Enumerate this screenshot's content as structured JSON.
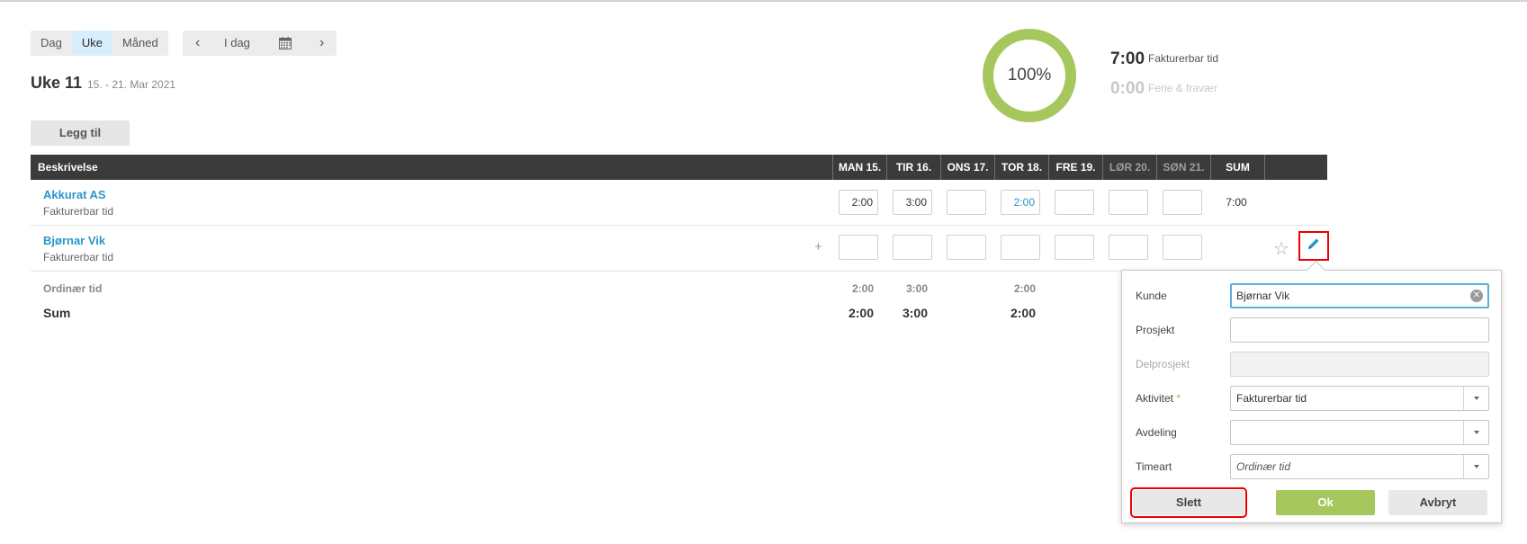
{
  "view_switch": {
    "day": "Dag",
    "week": "Uke",
    "month": "Måned",
    "active": "week"
  },
  "nav": {
    "prev": "‹",
    "today": "I dag",
    "calendar_icon": "calendar-icon",
    "next": "›"
  },
  "week": {
    "title": "Uke 11",
    "range": "15. - 21. Mar 2021"
  },
  "add_button": "Legg til",
  "summary": {
    "percent": "100%",
    "percent_value": 1.0,
    "billable_hours": "7:00",
    "billable_label": "Fakturerbar tid",
    "absence_hours": "0:00",
    "absence_label": "Ferie & fravær",
    "ring_color": "#a5c75c"
  },
  "table": {
    "headers": {
      "description": "Beskrivelse",
      "days": [
        "MAN 15.",
        "TIR 16.",
        "ONS 17.",
        "TOR 18.",
        "FRE 19.",
        "LØR 20.",
        "SØN 21."
      ],
      "sum": "SUM"
    },
    "rows": [
      {
        "name": "Akkurat AS",
        "activity": "Fakturerbar tid",
        "values": [
          "2:00",
          "3:00",
          "",
          "2:00",
          "",
          "",
          ""
        ],
        "sum": "7:00"
      },
      {
        "name": "Bjørnar Vik",
        "activity": "Fakturerbar tid",
        "values": [
          "",
          "",
          "",
          "",
          "",
          "",
          ""
        ],
        "sum": ""
      }
    ],
    "footer": {
      "ordinary_label": "Ordinær tid",
      "ordinary_values": [
        "2:00",
        "3:00",
        "",
        "2:00",
        "",
        "",
        ""
      ],
      "sum_label": "Sum",
      "sum_values": [
        "2:00",
        "3:00",
        "",
        "2:00",
        "",
        "",
        ""
      ]
    }
  },
  "row_icons": {
    "plus": "+",
    "star": "☆",
    "edit": "pencil-icon"
  },
  "popup": {
    "customer_label": "Kunde",
    "customer_value": "Bjørnar Vik",
    "project_label": "Prosjekt",
    "project_value": "",
    "subproject_label": "Delprosjekt",
    "activity_label": "Aktivitet",
    "required_mark": "*",
    "activity_value": "Fakturerbar tid",
    "department_label": "Avdeling",
    "department_value": "",
    "hour_type_label": "Timeart",
    "hour_type_value": "Ordinær tid",
    "delete_button": "Slett",
    "ok_button": "Ok",
    "cancel_button": "Avbryt"
  }
}
